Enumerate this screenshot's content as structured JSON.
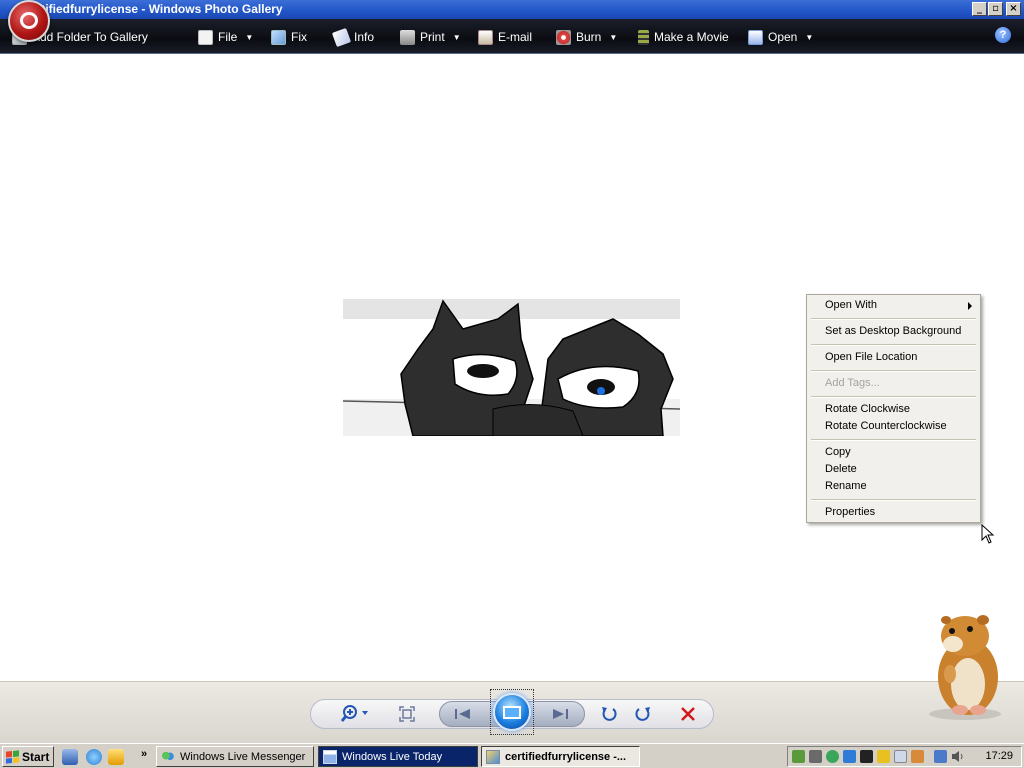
{
  "window": {
    "title": "ertifiedfurrylicense - Windows Photo Gallery",
    "minimize_icon": "minimize-icon",
    "maximize_icon": "restore-icon",
    "close_icon": "close-icon"
  },
  "toolbar": {
    "items": [
      {
        "label": "Add Folder To Gallery",
        "icon": "add-folder-icon"
      },
      {
        "label": "File",
        "icon": "file-icon",
        "dropdown": true
      },
      {
        "label": "Fix",
        "icon": "fix-icon"
      },
      {
        "label": "Info",
        "icon": "info-tag-icon"
      },
      {
        "label": "Print",
        "icon": "printer-icon",
        "dropdown": true
      },
      {
        "label": "E-mail",
        "icon": "email-icon"
      },
      {
        "label": "Burn",
        "icon": "disc-icon",
        "dropdown": true
      },
      {
        "label": "Make a Movie",
        "icon": "film-icon"
      },
      {
        "label": "Open",
        "icon": "open-icon",
        "dropdown": true
      }
    ],
    "help_icon": "help-icon",
    "help_label": "?"
  },
  "context_menu": {
    "items": [
      {
        "label": "Open With",
        "submenu": true
      },
      {
        "label": "Set as Desktop Background"
      },
      {
        "label": "Open File Location"
      },
      {
        "label": "Add Tags...",
        "disabled": true
      },
      {
        "label": "Rotate Clockwise"
      },
      {
        "label": "Rotate Counterclockwise"
      },
      {
        "label": "Copy"
      },
      {
        "label": "Delete"
      },
      {
        "label": "Rename"
      },
      {
        "label": "Properties"
      }
    ]
  },
  "controls": {
    "zoom_icon": "zoom-icon",
    "fit_icon": "actual-size-icon",
    "previous_icon": "previous-icon",
    "slideshow_icon": "slideshow-icon",
    "next_icon": "next-icon",
    "rotate_ccw_icon": "rotate-counterclockwise-icon",
    "rotate_cw_icon": "rotate-clockwise-icon",
    "delete_icon": "delete-icon"
  },
  "taskbar": {
    "start_label": "Start",
    "more_label": "»",
    "tasks": [
      {
        "label": "Windows Live Messenger",
        "icon": "messenger-icon",
        "state": "normal"
      },
      {
        "label": "Windows Live Today",
        "icon": "window-icon",
        "state": "highlight"
      },
      {
        "label": "certifiedfurrylicense -...",
        "icon": "gallery-icon",
        "state": "active"
      }
    ],
    "clock": "17:29"
  },
  "colors": {
    "titlebar": "#2155c7",
    "toolbar": "#0b0c12",
    "menu_bg": "#f1f0ec",
    "taskbar": "#d4d0c8",
    "highlight_task": "#0a246a",
    "delete_red": "#d01818"
  }
}
